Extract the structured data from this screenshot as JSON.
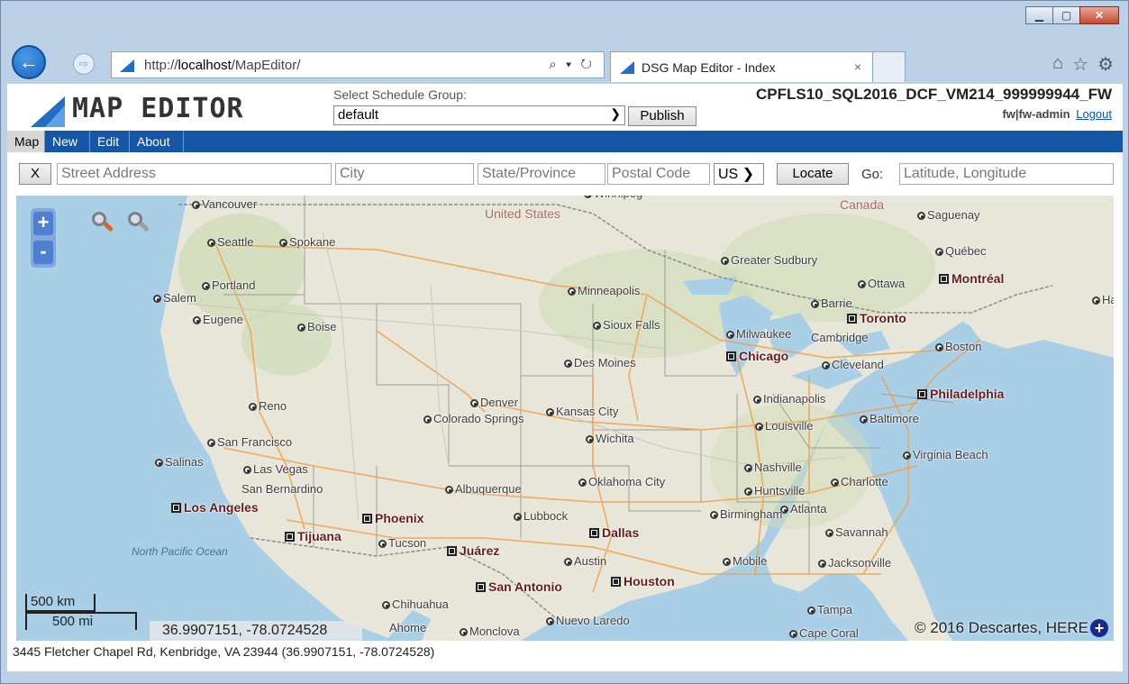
{
  "browser": {
    "url_prefix": "http://",
    "url_host": "localhost",
    "url_path": "/MapEditor/",
    "addr_tools": "⌕ ▾ ↻",
    "tab_title": "DSG Map Editor - Index",
    "tab_close": "×",
    "icons": [
      "home-icon",
      "star-icon",
      "gear-icon"
    ]
  },
  "header": {
    "logo_text": "MAP EDITOR",
    "schedule_label": "Select Schedule Group:",
    "schedule_value": "default",
    "publish_label": "Publish",
    "server_name": "CPFLS10_SQL2016_DCF_VM214_999999944_FW",
    "user": "fw|fw-admin",
    "logout": "Logout"
  },
  "menu": [
    {
      "label": "Map",
      "active": true
    },
    {
      "label": "New"
    },
    {
      "label": "Edit"
    },
    {
      "label": "About"
    }
  ],
  "search": {
    "clear_label": "X",
    "street_placeholder": "Street Address",
    "city_placeholder": "City",
    "state_placeholder": "State/Province",
    "postal_placeholder": "Postal Code",
    "country_value": "US",
    "locate_label": "Locate",
    "go_label": "Go:",
    "latlng_placeholder": "Latitude, Longitude"
  },
  "map": {
    "zoom_in": "+",
    "zoom_out": "-",
    "regions": [
      "United States",
      "Canada"
    ],
    "ocean": "North Pacific Ocean",
    "cities": [
      {
        "name": "Vancouver",
        "marker": "dot"
      },
      {
        "name": "Seattle",
        "marker": "dot"
      },
      {
        "name": "Spokane",
        "marker": "dot"
      },
      {
        "name": "Portland",
        "marker": "dot"
      },
      {
        "name": "Salem",
        "marker": "dot"
      },
      {
        "name": "Eugene",
        "marker": "dot"
      },
      {
        "name": "Boise",
        "marker": "dot"
      },
      {
        "name": "Reno",
        "marker": "dot"
      },
      {
        "name": "San Francisco",
        "marker": "dot"
      },
      {
        "name": "Salinas",
        "marker": "dot"
      },
      {
        "name": "Las Vegas",
        "marker": "dot"
      },
      {
        "name": "San Bernardino",
        "marker": "none"
      },
      {
        "name": "Los Angeles",
        "marker": "sq",
        "big": true
      },
      {
        "name": "Tijuana",
        "marker": "sq",
        "big": true
      },
      {
        "name": "Phoenix",
        "marker": "sq",
        "big": true
      },
      {
        "name": "Tucson",
        "marker": "dot"
      },
      {
        "name": "Juárez",
        "marker": "sq",
        "big": true
      },
      {
        "name": "Chihuahua",
        "marker": "dot"
      },
      {
        "name": "Ahome",
        "marker": "none"
      },
      {
        "name": "Monclova",
        "marker": "dot"
      },
      {
        "name": "Denver",
        "marker": "dot"
      },
      {
        "name": "Colorado Springs",
        "marker": "dot"
      },
      {
        "name": "Albuquerque",
        "marker": "dot"
      },
      {
        "name": "Lubbock",
        "marker": "dot"
      },
      {
        "name": "Dallas",
        "marker": "sq",
        "big": true
      },
      {
        "name": "Austin",
        "marker": "dot"
      },
      {
        "name": "San Antonio",
        "marker": "sq",
        "big": true
      },
      {
        "name": "Houston",
        "marker": "sq",
        "big": true
      },
      {
        "name": "Nuevo Laredo",
        "marker": "dot"
      },
      {
        "name": "Oklahoma City",
        "marker": "dot"
      },
      {
        "name": "Wichita",
        "marker": "dot"
      },
      {
        "name": "Kansas City",
        "marker": "dot"
      },
      {
        "name": "Des Moines",
        "marker": "dot"
      },
      {
        "name": "Sioux Falls",
        "marker": "dot"
      },
      {
        "name": "Minneapolis",
        "marker": "dot"
      },
      {
        "name": "Milwaukee",
        "marker": "dot"
      },
      {
        "name": "Chicago",
        "marker": "sq",
        "big": true
      },
      {
        "name": "Indianapolis",
        "marker": "dot"
      },
      {
        "name": "Louisville",
        "marker": "dot"
      },
      {
        "name": "Nashville",
        "marker": "dot"
      },
      {
        "name": "Huntsville",
        "marker": "dot"
      },
      {
        "name": "Atlanta",
        "marker": "dot"
      },
      {
        "name": "Birmingham",
        "marker": "dot"
      },
      {
        "name": "Mobile",
        "marker": "dot"
      },
      {
        "name": "Jacksonville",
        "marker": "dot"
      },
      {
        "name": "Savannah",
        "marker": "dot"
      },
      {
        "name": "Charlotte",
        "marker": "dot"
      },
      {
        "name": "Tampa",
        "marker": "dot"
      },
      {
        "name": "Cape Coral",
        "marker": "dot"
      },
      {
        "name": "Cleveland",
        "marker": "dot"
      },
      {
        "name": "Greater Sudbury",
        "marker": "dot"
      },
      {
        "name": "Barrie",
        "marker": "dot"
      },
      {
        "name": "Toronto",
        "marker": "sq",
        "big": true
      },
      {
        "name": "Cambridge",
        "marker": "none"
      },
      {
        "name": "Ottawa",
        "marker": "dot"
      },
      {
        "name": "Montréal",
        "marker": "sq",
        "big": true
      },
      {
        "name": "Québec",
        "marker": "dot"
      },
      {
        "name": "Saguenay",
        "marker": "dot"
      },
      {
        "name": "Boston",
        "marker": "dot"
      },
      {
        "name": "Philadelphia",
        "marker": "sq",
        "big": true
      },
      {
        "name": "Baltimore",
        "marker": "dot"
      },
      {
        "name": "Virginia Beach",
        "marker": "dot"
      },
      {
        "name": "Winnipeg",
        "marker": "dot"
      },
      {
        "name": "Ha",
        "marker": "dot"
      }
    ],
    "scale_km": "500 km",
    "scale_mi": "500 mi",
    "coord_readout": "36.9907151, -78.0724528",
    "copyright": "© 2016 Descartes, HERE",
    "plus_label": "+"
  },
  "status": {
    "text": "3445 Fletcher Chapel Rd, Kenbridge, VA 23944 (36.9907151, -78.0724528)"
  }
}
